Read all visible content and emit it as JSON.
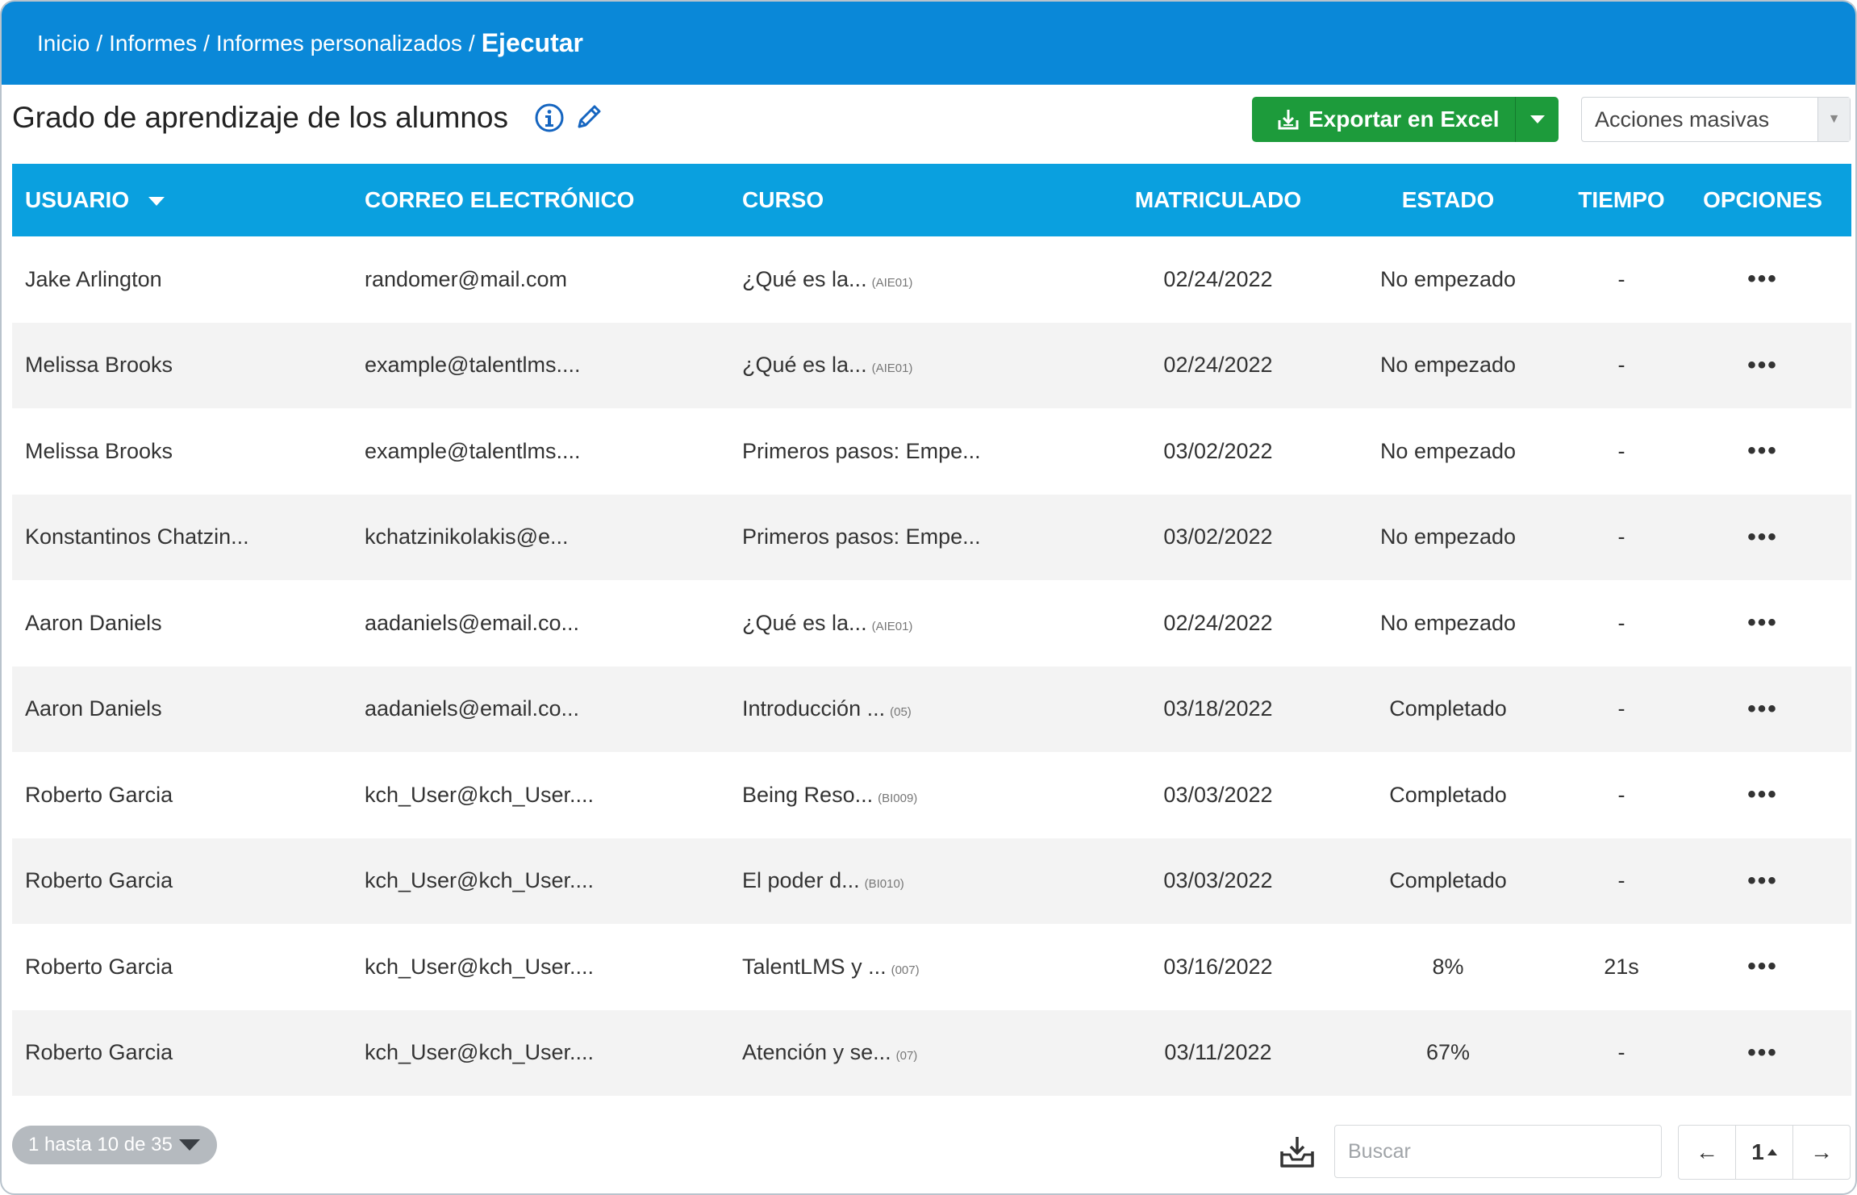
{
  "breadcrumb": {
    "items": [
      "Inicio",
      "Informes",
      "Informes personalizados"
    ],
    "separator": "/",
    "current": "Ejecutar"
  },
  "page": {
    "title": "Grado de aprendizaje de los alumnos",
    "info_icon": "info-circle-icon",
    "edit_icon": "pencil-icon"
  },
  "toolbar": {
    "export_label": "Exportar en Excel",
    "bulk_actions_label": "Acciones masivas"
  },
  "table": {
    "headers": {
      "user": "USUARIO",
      "email": "CORREO ELECTRÓNICO",
      "course": "CURSO",
      "enrolled": "MATRICULADO",
      "status": "ESTADO",
      "time": "TIEMPO",
      "options": "OPCIONES"
    },
    "rows": [
      {
        "user": "Jake Arlington",
        "email": "randomer@mail.com",
        "course": "¿Qué es la...",
        "code": "(AIE01)",
        "enrolled": "02/24/2022",
        "status": "No empezado",
        "time": "-",
        "options": "•••"
      },
      {
        "user": "Melissa Brooks",
        "email": "example@talentlms....",
        "course": "¿Qué es la...",
        "code": "(AIE01)",
        "enrolled": "02/24/2022",
        "status": "No empezado",
        "time": "-",
        "options": "•••"
      },
      {
        "user": "Melissa Brooks",
        "email": "example@talentlms....",
        "course": "Primeros pasos: Empe...",
        "code": "",
        "enrolled": "03/02/2022",
        "status": "No empezado",
        "time": "-",
        "options": "•••"
      },
      {
        "user": "Konstantinos Chatzin...",
        "email": "kchatzinikolakis@e...",
        "course": "Primeros pasos: Empe...",
        "code": "",
        "enrolled": "03/02/2022",
        "status": "No empezado",
        "time": "-",
        "options": "•••"
      },
      {
        "user": "Aaron Daniels",
        "email": "aadaniels@email.co...",
        "course": "¿Qué es la...",
        "code": "(AIE01)",
        "enrolled": "02/24/2022",
        "status": "No empezado",
        "time": "-",
        "options": "•••"
      },
      {
        "user": "Aaron Daniels",
        "email": "aadaniels@email.co...",
        "course": "Introducción ...",
        "code": "(05)",
        "enrolled": "03/18/2022",
        "status": "Completado",
        "time": "-",
        "options": "•••"
      },
      {
        "user": "Roberto Garcia",
        "email": "kch_User@kch_User....",
        "course": "Being Reso...",
        "code": "(BI009)",
        "enrolled": "03/03/2022",
        "status": "Completado",
        "time": "-",
        "options": "•••"
      },
      {
        "user": "Roberto Garcia",
        "email": "kch_User@kch_User....",
        "course": "El poder d...",
        "code": "(BI010)",
        "enrolled": "03/03/2022",
        "status": "Completado",
        "time": "-",
        "options": "•••"
      },
      {
        "user": "Roberto Garcia",
        "email": "kch_User@kch_User....",
        "course": "TalentLMS y ...",
        "code": "(007)",
        "enrolled": "03/16/2022",
        "status": "8%",
        "time": "21s",
        "options": "•••"
      },
      {
        "user": "Roberto Garcia",
        "email": "kch_User@kch_User....",
        "course": "Atención y se...",
        "code": "(07)",
        "enrolled": "03/11/2022",
        "status": "67%",
        "time": "-",
        "options": "•••"
      }
    ]
  },
  "footer": {
    "range_label": "1 hasta 10 de 35",
    "download_icon": "download-tray-icon",
    "search_placeholder": "Buscar",
    "search_value": "",
    "pagination": {
      "prev": "←",
      "current": "1",
      "next": "→"
    }
  },
  "colors": {
    "topbar": "#0a88d8",
    "table_header": "#0aa0df",
    "export_button": "#1d9b3b",
    "alt_row": "#f3f3f3",
    "icon_blue": "#1565c0"
  }
}
